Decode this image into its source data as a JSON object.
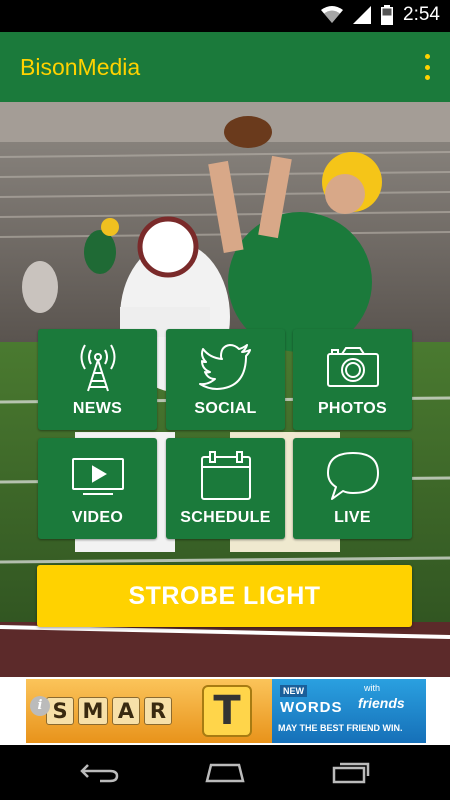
{
  "status_bar": {
    "time": "2:54",
    "icons": [
      "wifi-icon",
      "cell-signal-icon",
      "battery-icon"
    ]
  },
  "app_bar": {
    "title": "BisonMedia",
    "menu_icon": "overflow-menu-icon"
  },
  "colors": {
    "brand_green": "#1b7a3b",
    "brand_yellow": "#ffd200"
  },
  "tiles": [
    {
      "label": "NEWS",
      "icon": "radio-tower-icon"
    },
    {
      "label": "SOCIAL",
      "icon": "twitter-bird-icon"
    },
    {
      "label": "PHOTOS",
      "icon": "camera-icon"
    },
    {
      "label": "VIDEO",
      "icon": "video-play-icon"
    },
    {
      "label": "SCHEDULE",
      "icon": "calendar-icon"
    },
    {
      "label": "LIVE",
      "icon": "speech-bubble-icon"
    }
  ],
  "strobe_button": {
    "label": "STROBE LIGHT"
  },
  "ad": {
    "left_letters": [
      "S",
      "M",
      "A",
      "R",
      "T"
    ],
    "right_badge": "NEW",
    "right_words": "WORDS",
    "right_with": "with",
    "right_friends": "friends",
    "right_tagline": "MAY THE BEST FRIEND WIN."
  },
  "nav_bar": {
    "buttons": [
      "back-icon",
      "home-icon",
      "recents-icon"
    ]
  }
}
